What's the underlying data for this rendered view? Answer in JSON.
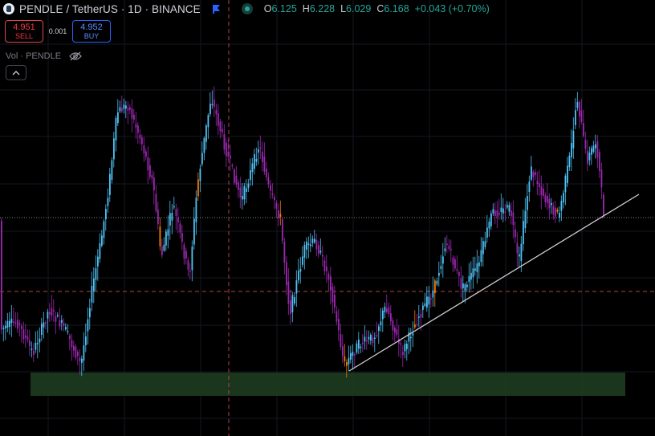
{
  "header": {
    "symbol_title": "PENDLE / TetherUS · 1D · BINANCE",
    "ohlc": {
      "open_label": "O",
      "open": "6.125",
      "high_label": "H",
      "high": "6.228",
      "low_label": "L",
      "low": "6.029",
      "close_label": "C",
      "close": "6.168",
      "change": "+0.043 (+0.70%)"
    }
  },
  "trade": {
    "sell_price": "4.951",
    "sell_label": "SELL",
    "spread": "0.001",
    "buy_price": "4.952",
    "buy_label": "BUY"
  },
  "volume_legend": "Vol · PENDLE",
  "icons": {
    "symbol_logo": "pendle-logo-icon",
    "flag": "flag-icon",
    "market_status": "live-dot-icon",
    "visibility": "eye-off-icon",
    "collapse": "chevron-up-icon"
  },
  "colors": {
    "up_candle": "#4fc3f7",
    "down_candle": "#9c27b0",
    "highlight_candle": "#f57c00",
    "support_zone": "#1b3a1f",
    "trendline": "#cfcfcf",
    "crosshair": "#b3424a",
    "sell": "#f23645",
    "buy": "#2962ff",
    "ohlc_value": "#26a69a"
  }
}
